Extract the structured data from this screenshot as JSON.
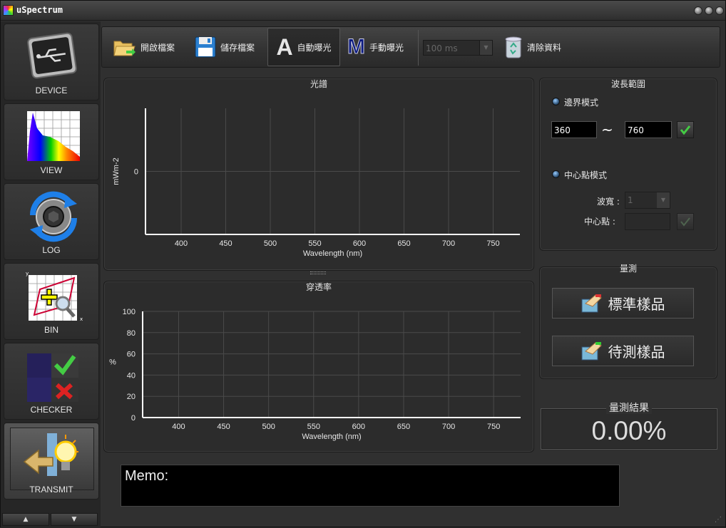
{
  "app": {
    "title": "uSpectrum"
  },
  "sidebar": {
    "items": [
      {
        "label": "DEVICE",
        "icon": "usb-device-icon"
      },
      {
        "label": "VIEW",
        "icon": "spectrum-view-icon"
      },
      {
        "label": "LOG",
        "icon": "refresh-log-icon"
      },
      {
        "label": "BIN",
        "icon": "bin-magnifier-icon"
      },
      {
        "label": "CHECKER",
        "icon": "checker-icon"
      },
      {
        "label": "TRANSMIT",
        "icon": "transmit-bulb-icon"
      }
    ],
    "nav_up": "▲",
    "nav_down": "▼"
  },
  "toolbar": {
    "open_label": "開啟檔案",
    "save_label": "儲存檔案",
    "auto_exposure_label": "自動曝光",
    "manual_exposure_label": "手動曝光",
    "exposure_time": "100 ms",
    "clear_label": "清除資料"
  },
  "spectrum_panel": {
    "title": "光譜"
  },
  "transmittance_panel": {
    "title": "穿透率"
  },
  "wavelength_panel": {
    "title": "波長範圍",
    "boundary_mode_label": "邊界模式",
    "min_value": "360",
    "tilde": "~",
    "max_value": "760",
    "center_mode_label": "中心點模式",
    "bandwidth_label": "波寬 :",
    "bandwidth_value": "1",
    "center_label": "中心點 :",
    "center_value": ""
  },
  "measure_panel": {
    "title": "量測",
    "standard_sample_label": "標準樣品",
    "test_sample_label": "待測樣品"
  },
  "result": {
    "title": "量測結果",
    "value": "0.00%"
  },
  "memo": {
    "label": "Memo:"
  },
  "chart_data": [
    {
      "type": "line",
      "title": "光譜",
      "xlabel": "Wavelength (nm)",
      "ylabel": "mWm-2",
      "xlim": [
        360,
        780
      ],
      "xticks": [
        400,
        450,
        500,
        550,
        600,
        650,
        700,
        750
      ],
      "yticks": [
        0
      ],
      "grid": true,
      "series": []
    },
    {
      "type": "line",
      "title": "穿透率",
      "xlabel": "Wavelength (nm)",
      "ylabel": "%",
      "xlim": [
        360,
        780
      ],
      "ylim": [
        0,
        100
      ],
      "xticks": [
        400,
        450,
        500,
        550,
        600,
        650,
        700,
        750
      ],
      "yticks": [
        0,
        20,
        40,
        60,
        80,
        100
      ],
      "grid": true,
      "series": []
    }
  ]
}
